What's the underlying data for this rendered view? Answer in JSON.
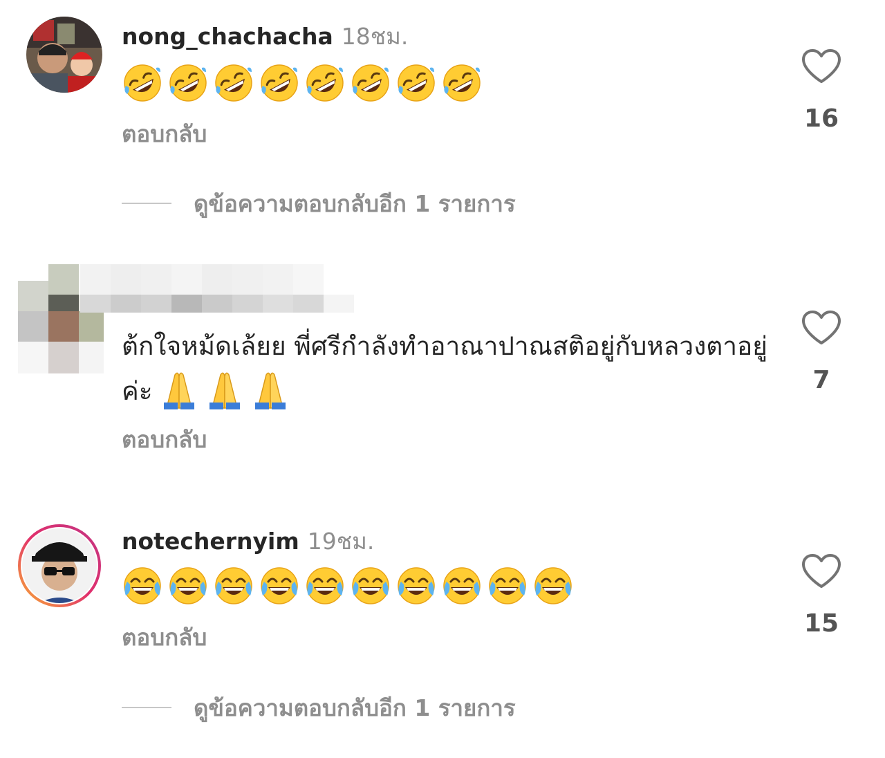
{
  "comments": [
    {
      "username": "nong_chachacha",
      "time": "18ชม.",
      "reply_label": "ตอบกลับ",
      "like_count": "16",
      "view_replies": "ดูข้อความตอบกลับอีก 1 รายการ",
      "emoji_name": "rolling-on-the-floor-laughing",
      "emoji_count": 8
    },
    {
      "text": "ต้กใจหม้ดเล้ยย พี่ศรีกำลังทำอาณาปาณสติอยู่กับหลวงตาอยู่ค่ะ",
      "reply_label": "ตอบกลับ",
      "like_count": "7",
      "emoji_name": "folded-hands",
      "emoji_count": 3
    },
    {
      "username": "notechernyim",
      "time": "19ชม.",
      "reply_label": "ตอบกลับ",
      "like_count": "15",
      "view_replies": "ดูข้อความตอบกลับอีก 1 รายการ",
      "emoji_name": "face-with-tears-of-joy",
      "emoji_count": 10
    }
  ],
  "colors": {
    "text": "#262626",
    "secondary": "#8e8e8e",
    "like_count": "#545454",
    "divider": "#c7c7c7",
    "story_ring_start": "#f9b233",
    "story_ring_end": "#c13584"
  }
}
